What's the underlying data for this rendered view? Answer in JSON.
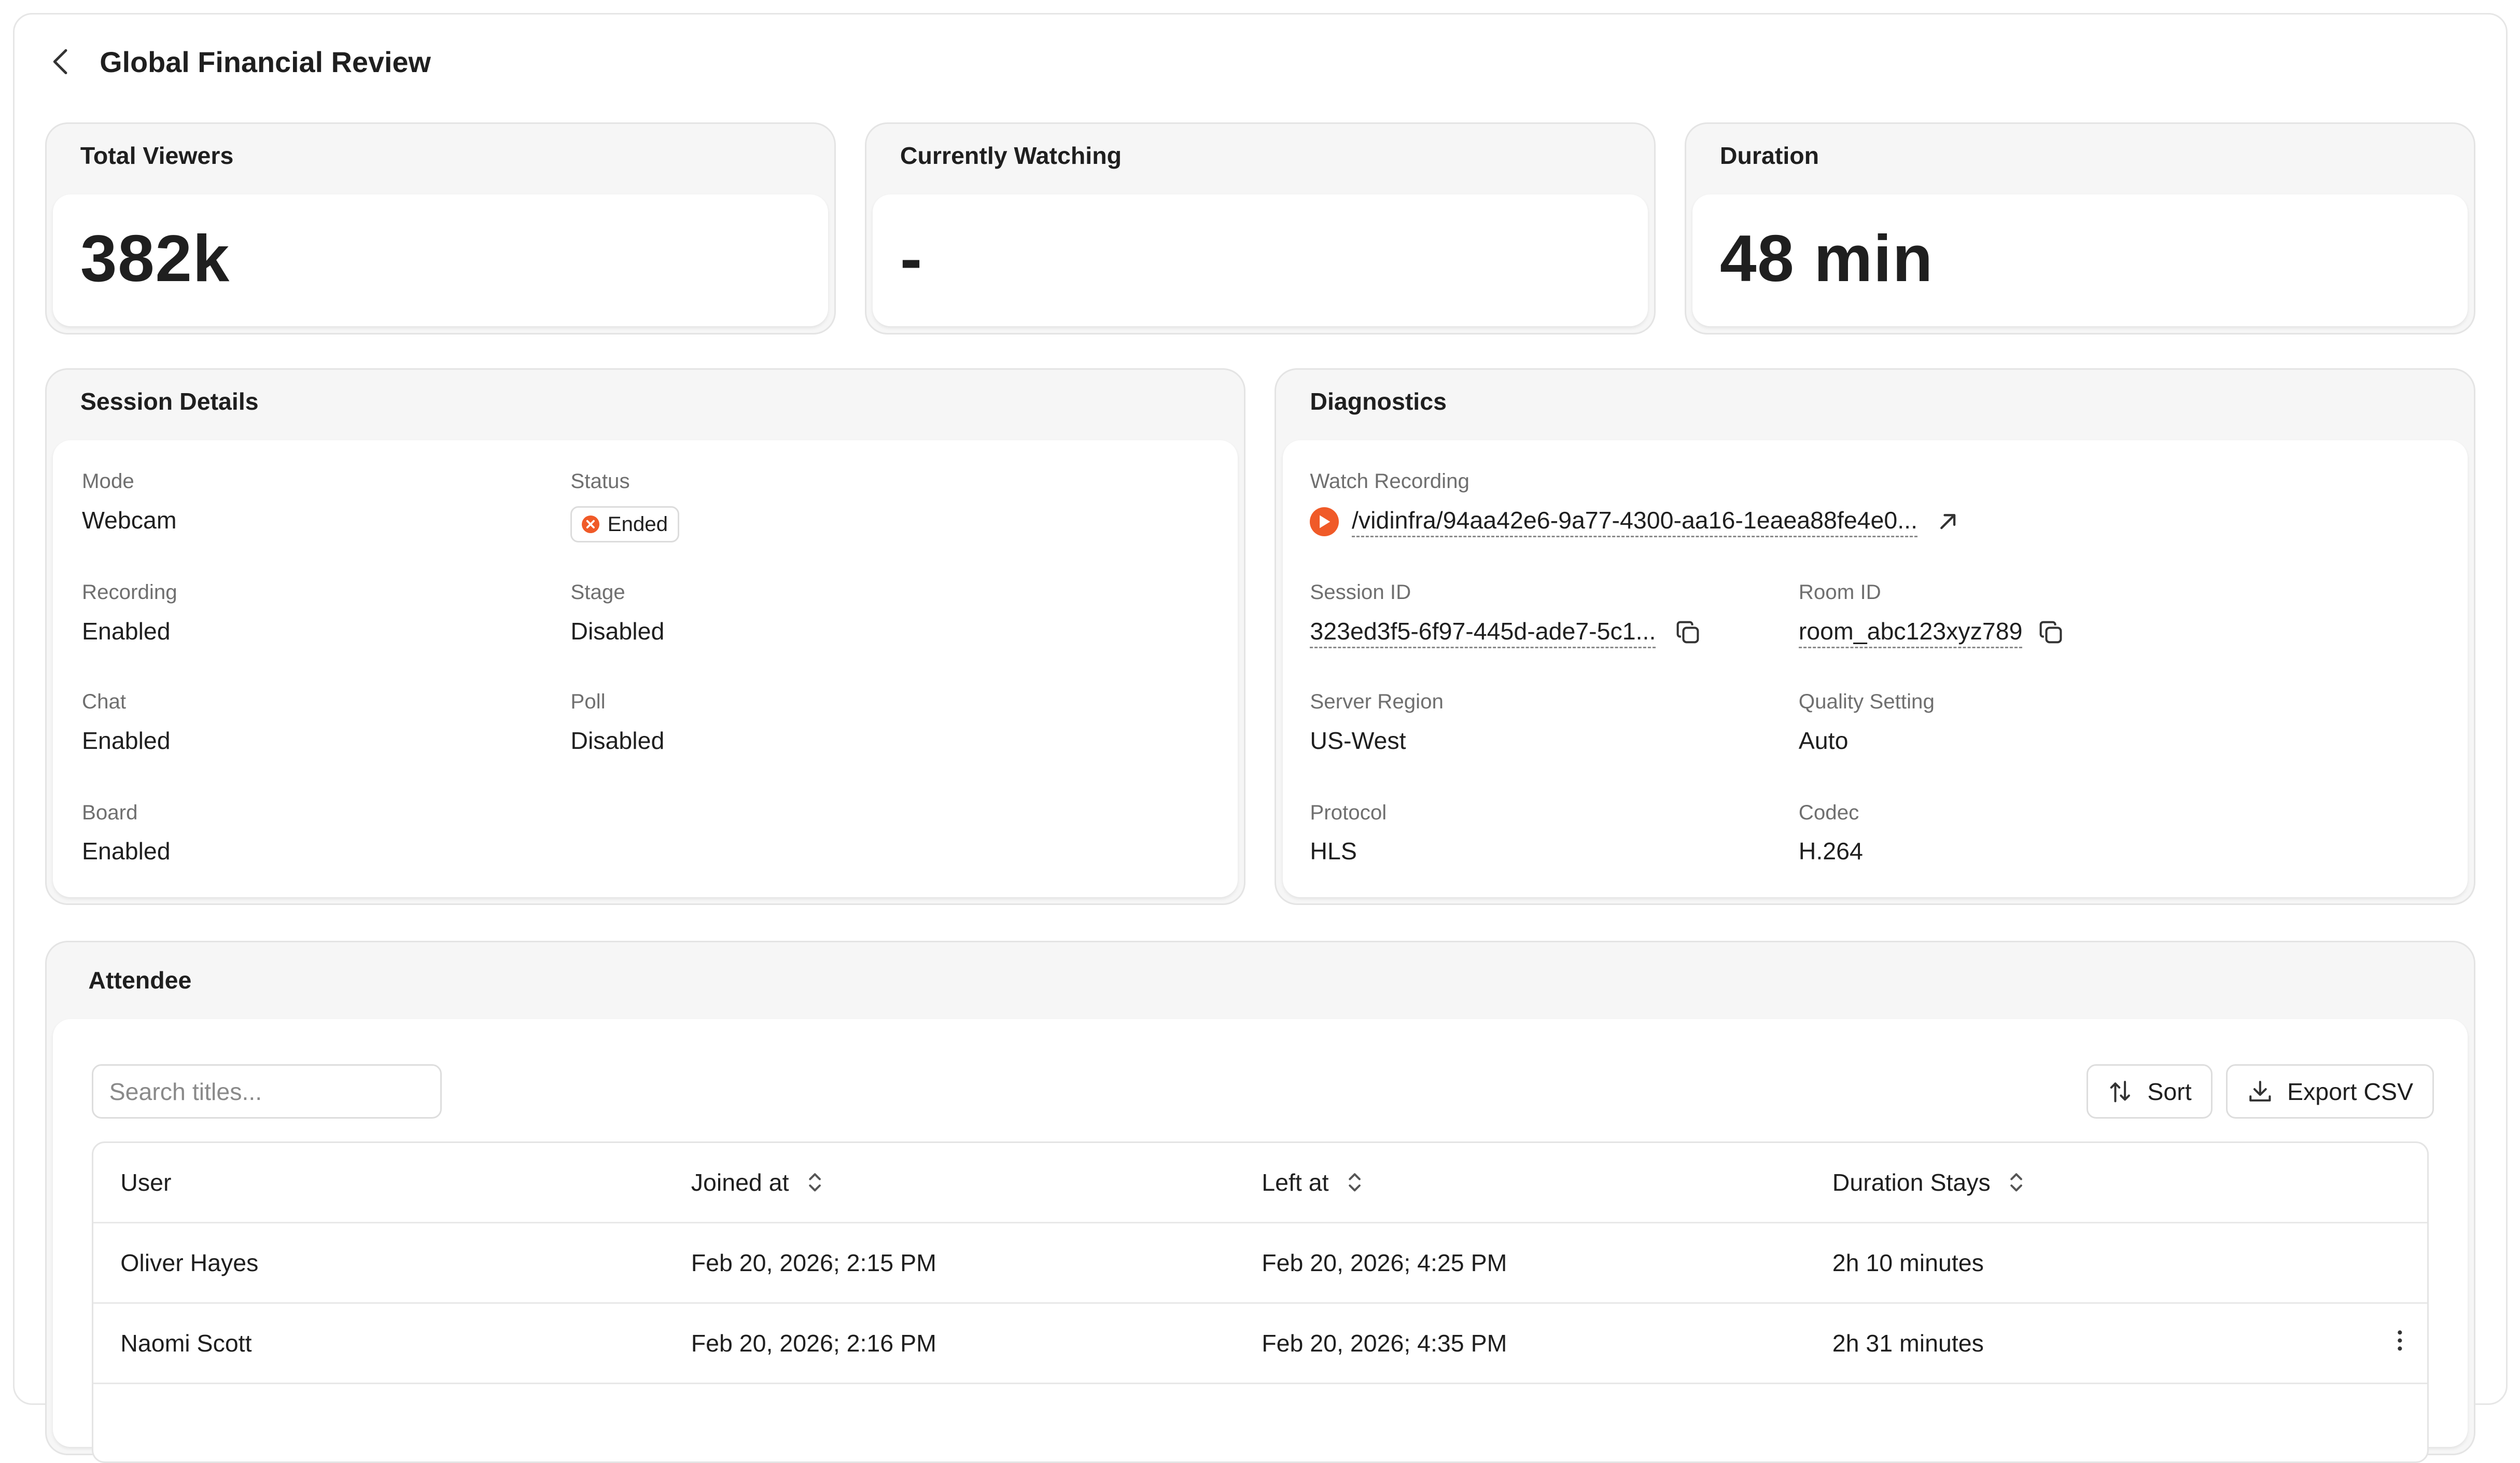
{
  "header": {
    "title": "Global Financial Review"
  },
  "metrics": [
    {
      "label": "Total Viewers",
      "value": "382k"
    },
    {
      "label": "Currently Watching",
      "value": "-"
    },
    {
      "label": "Duration",
      "value": "48 min"
    }
  ],
  "session": {
    "title": "Session Details",
    "fields": [
      {
        "label": "Mode",
        "value": "Webcam"
      },
      {
        "label": "Status",
        "value": "Ended"
      },
      {
        "label": "Recording",
        "value": "Enabled"
      },
      {
        "label": "Stage",
        "value": "Disabled"
      },
      {
        "label": "Chat",
        "value": "Enabled"
      },
      {
        "label": "Poll",
        "value": "Disabled"
      },
      {
        "label": "Board",
        "value": "Enabled"
      }
    ],
    "status_color": "#f05a28"
  },
  "diagnostics": {
    "title": "Diagnostics",
    "recording_label": "Watch Recording",
    "recording_path": "/vidinfra/94aa42e6-9a77-4300-aa16-1eaea88fe4e0...",
    "session_id_label": "Session ID",
    "session_id": "323ed3f5-6f97-445d-ade7-5c1...",
    "room_id_label": "Room ID",
    "room_id": "room_abc123xyz789",
    "region_label": "Server Region",
    "region": "US-West",
    "quality_label": "Quality Setting",
    "quality": "Auto",
    "protocol_label": "Protocol",
    "protocol": "HLS",
    "codec_label": "Codec",
    "codec": "H.264"
  },
  "attendee": {
    "title": "Attendee",
    "search_placeholder": "Search titles...",
    "sort_label": "Sort",
    "export_label": "Export CSV",
    "columns": [
      "User",
      "Joined at",
      "Left at",
      "Duration Stays"
    ],
    "rows": [
      {
        "user": "Oliver Hayes",
        "joined": "Feb 20, 2026; 2:15 PM",
        "left": "Feb 20, 2026; 4:25 PM",
        "duration": "2h 10 minutes"
      },
      {
        "user": "Naomi Scott",
        "joined": "Feb 20, 2026; 2:16 PM",
        "left": "Feb 20, 2026; 4:35 PM",
        "duration": "2h 31 minutes"
      }
    ]
  },
  "icons": {
    "back": "chevron-left-icon",
    "status": "x-circle-icon",
    "play": "play-icon",
    "external": "arrow-up-right-icon",
    "copy": "copy-icon",
    "sort": "arrows-up-down-icon",
    "export": "download-icon",
    "column_sort": "chevron-up-down-icon",
    "more": "more-vertical-icon"
  },
  "colors": {
    "accent": "#f05a28",
    "card_bg": "#f6f6f6",
    "border": "#e4e4e4"
  }
}
